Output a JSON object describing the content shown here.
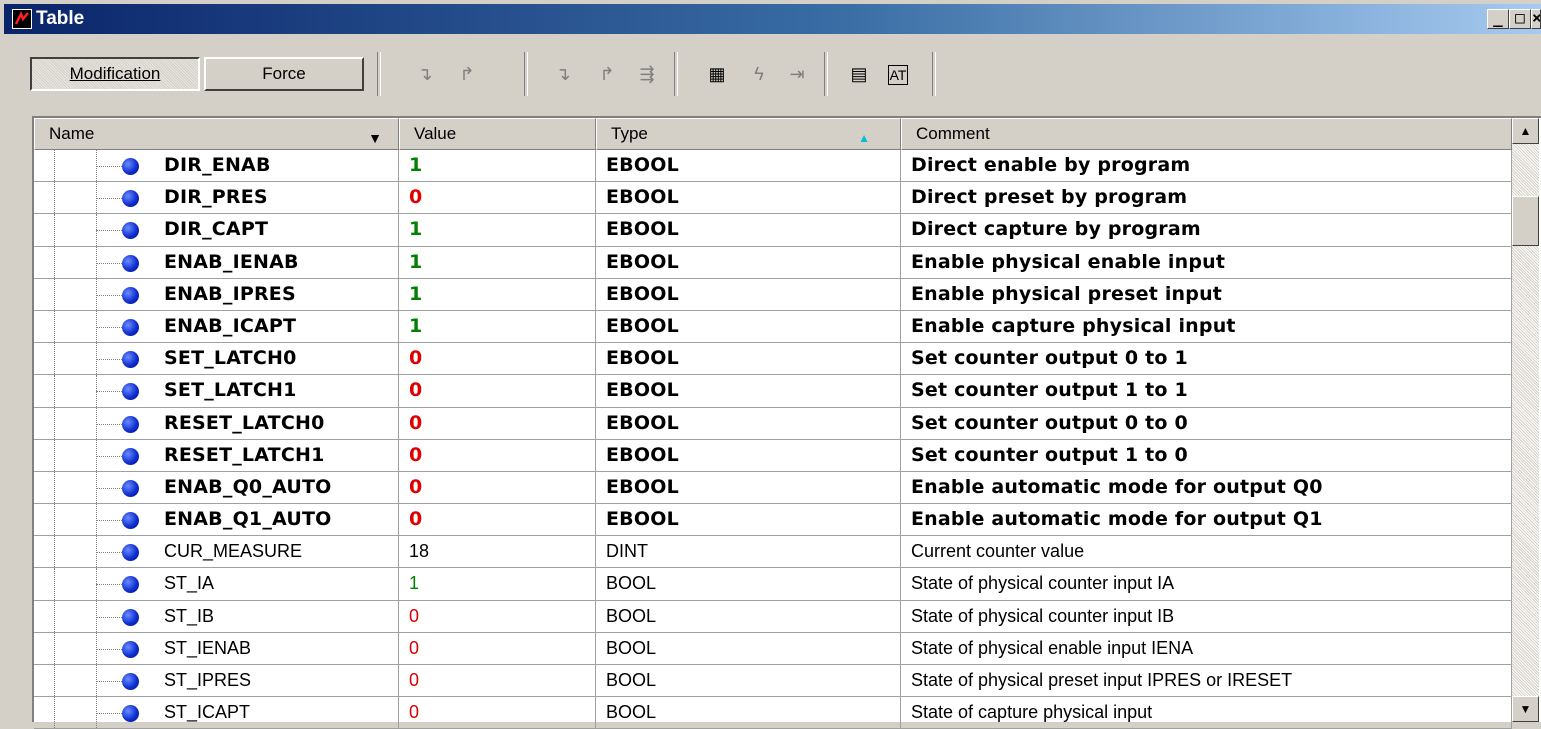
{
  "window": {
    "title": "Table",
    "minimize": "_",
    "maximize": "□",
    "close": "×"
  },
  "toolbar": {
    "modification_label": "Modification",
    "force_label": "Force"
  },
  "columns": {
    "name": "Name",
    "value": "Value",
    "type": "Type",
    "comment": "Comment"
  },
  "colors": {
    "value_one": "#008000",
    "value_zero": "#e00000"
  },
  "rows": [
    {
      "name": "DIR_ENAB",
      "value": "1",
      "type": "EBOOL",
      "comment": "Direct enable by program"
    },
    {
      "name": "DIR_PRES",
      "value": "0",
      "type": "EBOOL",
      "comment": "Direct preset by program"
    },
    {
      "name": "DIR_CAPT",
      "value": "1",
      "type": "EBOOL",
      "comment": "Direct capture by program"
    },
    {
      "name": "ENAB_IENAB",
      "value": "1",
      "type": "EBOOL",
      "comment": "Enable physical enable input"
    },
    {
      "name": "ENAB_IPRES",
      "value": "1",
      "type": "EBOOL",
      "comment": "Enable physical preset input"
    },
    {
      "name": "ENAB_ICAPT",
      "value": "1",
      "type": "EBOOL",
      "comment": "Enable capture physical input"
    },
    {
      "name": "SET_LATCH0",
      "value": "0",
      "type": "EBOOL",
      "comment": "Set counter output 0 to 1"
    },
    {
      "name": "SET_LATCH1",
      "value": "0",
      "type": "EBOOL",
      "comment": "Set counter output 1 to 1"
    },
    {
      "name": "RESET_LATCH0",
      "value": "0",
      "type": "EBOOL",
      "comment": "Set counter output 0 to 0"
    },
    {
      "name": "RESET_LATCH1",
      "value": "0",
      "type": "EBOOL",
      "comment": "Set counter output 1 to 0"
    },
    {
      "name": "ENAB_Q0_AUTO",
      "value": "0",
      "type": "EBOOL",
      "comment": "Enable automatic mode for output Q0"
    },
    {
      "name": "ENAB_Q1_AUTO",
      "value": "0",
      "type": "EBOOL",
      "comment": "Enable automatic mode for output Q1"
    },
    {
      "name": "CUR_MEASURE",
      "value": "18",
      "type": "DINT",
      "comment": "Current counter value"
    },
    {
      "name": "ST_IA",
      "value": "1",
      "type": "BOOL",
      "comment": "State of physical counter input IA"
    },
    {
      "name": "ST_IB",
      "value": "0",
      "type": "BOOL",
      "comment": "State of physical counter input IB"
    },
    {
      "name": "ST_IENAB",
      "value": "0",
      "type": "BOOL",
      "comment": "State of physical enable input IENA"
    },
    {
      "name": "ST_IPRES",
      "value": "0",
      "type": "BOOL",
      "comment": "State of physical preset input IPRES or IRESET"
    },
    {
      "name": "ST_ICAPT",
      "value": "0",
      "type": "BOOL",
      "comment": "State of capture physical input"
    }
  ]
}
